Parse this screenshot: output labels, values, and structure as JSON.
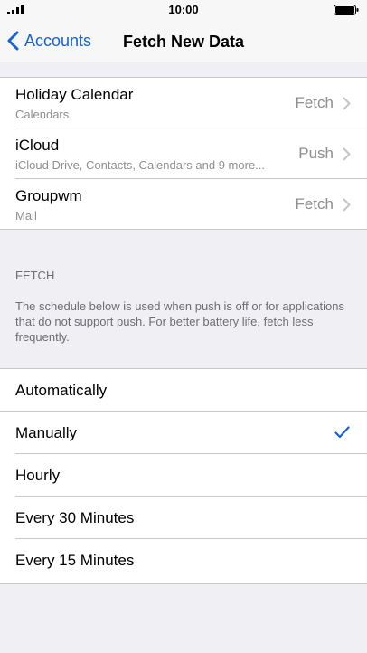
{
  "status": {
    "time": "10:00"
  },
  "nav": {
    "back_label": "Accounts",
    "title": "Fetch New Data"
  },
  "accounts": [
    {
      "title": "Holiday Calendar",
      "subtitle": "Calendars",
      "value": "Fetch"
    },
    {
      "title": "iCloud",
      "subtitle": "iCloud Drive, Contacts, Calendars and 9 more...",
      "value": "Push"
    },
    {
      "title": "Groupwm",
      "subtitle": "Mail",
      "value": "Fetch"
    }
  ],
  "fetch_section": {
    "header": "FETCH",
    "footer": "The schedule below is used when push is off or for applications that do not support push. For better battery life, fetch less frequently."
  },
  "options": [
    {
      "label": "Automatically",
      "selected": false
    },
    {
      "label": "Manually",
      "selected": true
    },
    {
      "label": "Hourly",
      "selected": false
    },
    {
      "label": "Every 30 Minutes",
      "selected": false
    },
    {
      "label": "Every 15 Minutes",
      "selected": false
    }
  ],
  "colors": {
    "accent": "#1562d6",
    "background": "#efeff4",
    "secondary_text": "#8e8e93"
  }
}
